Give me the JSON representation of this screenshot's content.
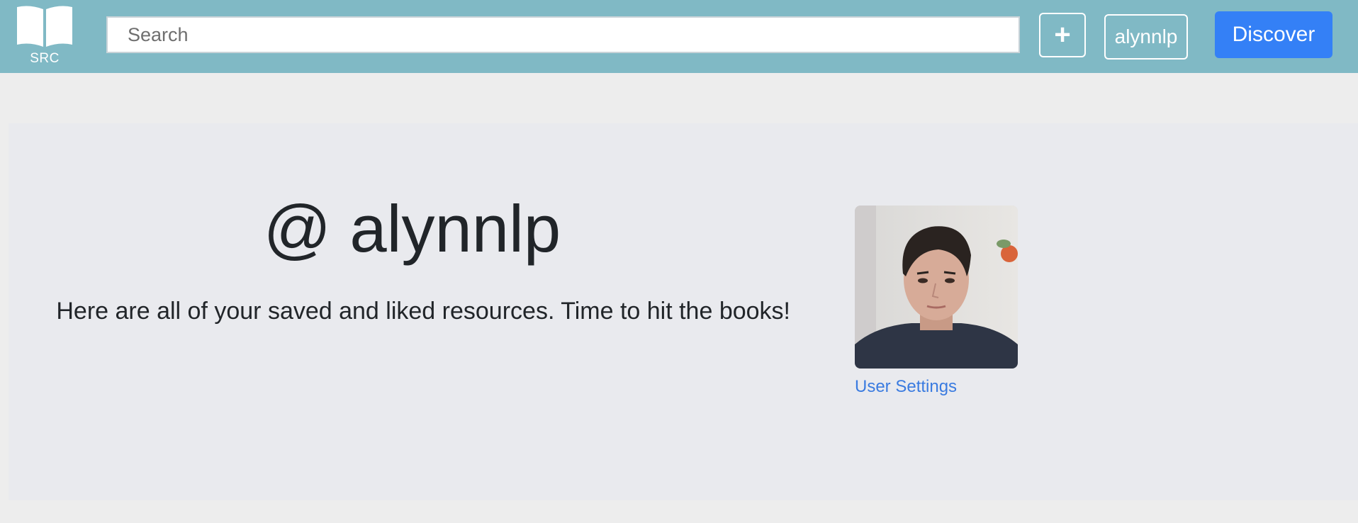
{
  "nav": {
    "logo_text": "SRC",
    "search_placeholder": "Search",
    "add_label": "+",
    "username": "alynnlp",
    "discover_label": "Discover"
  },
  "profile": {
    "handle": "@ alynnlp",
    "tagline": "Here are all of your saved and liked resources. Time to hit the books!",
    "settings_link": "User Settings"
  },
  "colors": {
    "navbar": "#80b9c5",
    "discover_button": "#3480f6",
    "link": "#3a7be0",
    "page_background": "#ededed",
    "hero_background": "#e9eaee"
  }
}
